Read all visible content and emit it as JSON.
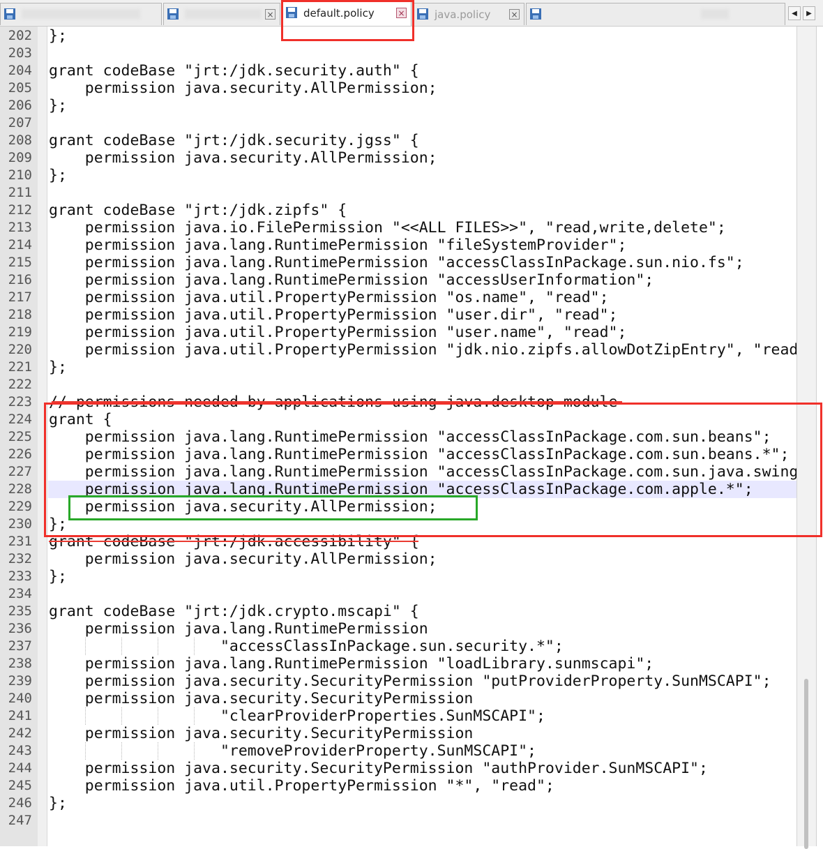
{
  "tabs": [
    {
      "label": "",
      "active": false
    },
    {
      "label": "",
      "active": false
    },
    {
      "label": "default.policy",
      "active": true
    },
    {
      "label": "java.policy",
      "active": false
    },
    {
      "label": "",
      "active": false
    }
  ],
  "tab_close_glyph": "×",
  "tab_scroll": {
    "left": "◀",
    "right": "▶"
  },
  "icons": [
    "save-icon",
    "close-icon",
    "scroll-left-icon",
    "scroll-right-icon"
  ],
  "editor": {
    "current_line": 228,
    "lines": [
      {
        "n": "202",
        "text": "};"
      },
      {
        "n": "203",
        "text": ""
      },
      {
        "n": "204",
        "text": "grant codeBase \"jrt:/jdk.security.auth\" {"
      },
      {
        "n": "205",
        "text": "    permission java.security.AllPermission;"
      },
      {
        "n": "206",
        "text": "};"
      },
      {
        "n": "207",
        "text": ""
      },
      {
        "n": "208",
        "text": "grant codeBase \"jrt:/jdk.security.jgss\" {"
      },
      {
        "n": "209",
        "text": "    permission java.security.AllPermission;"
      },
      {
        "n": "210",
        "text": "};"
      },
      {
        "n": "211",
        "text": ""
      },
      {
        "n": "212",
        "text": "grant codeBase \"jrt:/jdk.zipfs\" {"
      },
      {
        "n": "213",
        "text": "    permission java.io.FilePermission \"<<ALL FILES>>\", \"read,write,delete\";"
      },
      {
        "n": "214",
        "text": "    permission java.lang.RuntimePermission \"fileSystemProvider\";"
      },
      {
        "n": "215",
        "text": "    permission java.lang.RuntimePermission \"accessClassInPackage.sun.nio.fs\";"
      },
      {
        "n": "216",
        "text": "    permission java.lang.RuntimePermission \"accessUserInformation\";"
      },
      {
        "n": "217",
        "text": "    permission java.util.PropertyPermission \"os.name\", \"read\";"
      },
      {
        "n": "218",
        "text": "    permission java.util.PropertyPermission \"user.dir\", \"read\";"
      },
      {
        "n": "219",
        "text": "    permission java.util.PropertyPermission \"user.name\", \"read\";"
      },
      {
        "n": "220",
        "text": "    permission java.util.PropertyPermission \"jdk.nio.zipfs.allowDotZipEntry\", \"read"
      },
      {
        "n": "221",
        "text": "};"
      },
      {
        "n": "222",
        "text": ""
      },
      {
        "n": "223",
        "text": "// permissions needed by applications using java.desktop module"
      },
      {
        "n": "224",
        "text": "grant {"
      },
      {
        "n": "225",
        "text": "    permission java.lang.RuntimePermission \"accessClassInPackage.com.sun.beans\";"
      },
      {
        "n": "226",
        "text": "    permission java.lang.RuntimePermission \"accessClassInPackage.com.sun.beans.*\";"
      },
      {
        "n": "227",
        "text": "    permission java.lang.RuntimePermission \"accessClassInPackage.com.sun.java.swing"
      },
      {
        "n": "228",
        "text": "    permission java.lang.RuntimePermission \"accessClassInPackage.com.apple.*\";"
      },
      {
        "n": "229",
        "text": "    permission java.security.AllPermission;"
      },
      {
        "n": "230",
        "text": "};"
      },
      {
        "n": "231",
        "text": "grant codeBase \"jrt:/jdk.accessibility\" {"
      },
      {
        "n": "232",
        "text": "    permission java.security.AllPermission;"
      },
      {
        "n": "233",
        "text": "};"
      },
      {
        "n": "234",
        "text": ""
      },
      {
        "n": "235",
        "text": "grant codeBase \"jrt:/jdk.crypto.mscapi\" {"
      },
      {
        "n": "236",
        "text": "    permission java.lang.RuntimePermission"
      },
      {
        "n": "237",
        "text": "                   \"accessClassInPackage.sun.security.*\";"
      },
      {
        "n": "238",
        "text": "    permission java.lang.RuntimePermission \"loadLibrary.sunmscapi\";"
      },
      {
        "n": "239",
        "text": "    permission java.security.SecurityPermission \"putProviderProperty.SunMSCAPI\";"
      },
      {
        "n": "240",
        "text": "    permission java.security.SecurityPermission"
      },
      {
        "n": "241",
        "text": "                   \"clearProviderProperties.SunMSCAPI\";"
      },
      {
        "n": "242",
        "text": "    permission java.security.SecurityPermission"
      },
      {
        "n": "243",
        "text": "                   \"removeProviderProperty.SunMSCAPI\";"
      },
      {
        "n": "244",
        "text": "    permission java.security.SecurityPermission \"authProvider.SunMSCAPI\";"
      },
      {
        "n": "245",
        "text": "    permission java.util.PropertyPermission \"*\", \"read\";"
      },
      {
        "n": "246",
        "text": "};"
      },
      {
        "n": "247",
        "text": ""
      }
    ]
  },
  "colors": {
    "annotation_red": "#f0302a",
    "annotation_green": "#28a828",
    "current_line_bg": "#e8e8ff",
    "gutter_bg": "#e4e4e4"
  }
}
